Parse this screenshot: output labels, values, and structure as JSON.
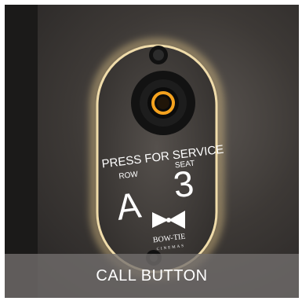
{
  "panel": {
    "prompt": "PRESS FOR SERVICE",
    "row_label": "ROW",
    "row_value": "A",
    "seat_label": "SEAT",
    "seat_value": "3",
    "brand": "BOW-TIE",
    "brand_sub": "CINEMAS"
  },
  "caption": {
    "label": "CALL BUTTON"
  },
  "colors": {
    "ring_glow": "#f5a21e",
    "panel_edge": "#e6c98a"
  }
}
